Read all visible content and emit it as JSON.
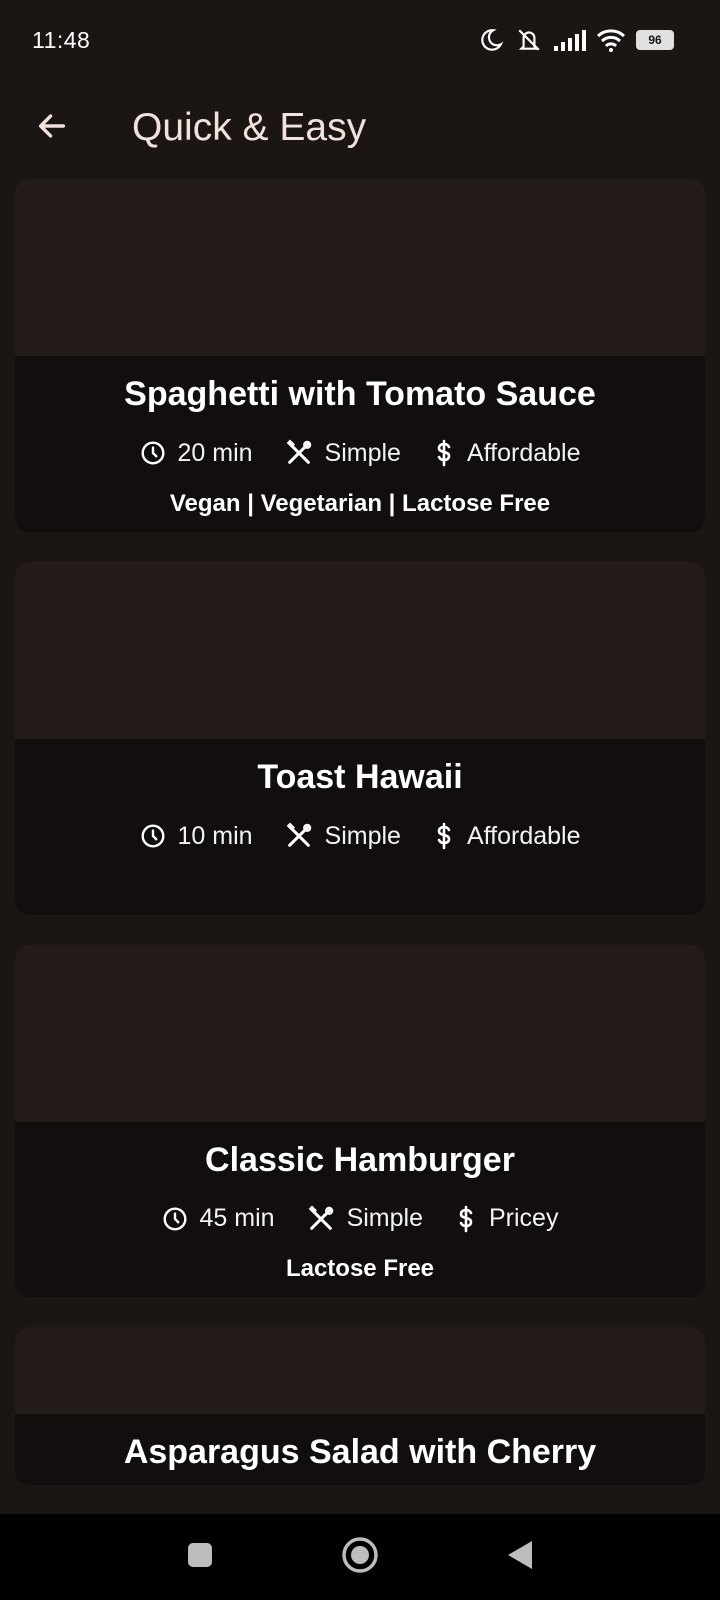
{
  "status_bar": {
    "time": "11:48",
    "battery": "96",
    "icons": [
      "moon-icon",
      "mute-icon",
      "signal-icon",
      "wifi-icon",
      "battery-icon"
    ]
  },
  "app_bar": {
    "title": "Quick & Easy",
    "back_icon": "arrow-back-icon"
  },
  "meals": [
    {
      "title": "Spaghetti with Tomato Sauce",
      "duration": "20 min",
      "complexity": "Simple",
      "affordability": "Affordable",
      "tags": "Vegan | Vegetarian | Lactose Free"
    },
    {
      "title": "Toast Hawaii",
      "duration": "10 min",
      "complexity": "Simple",
      "affordability": "Affordable",
      "tags": ""
    },
    {
      "title": "Classic Hamburger",
      "duration": "45 min",
      "complexity": "Simple",
      "affordability": "Pricey",
      "tags": "Lactose Free"
    },
    {
      "title": "Asparagus Salad with Cherry",
      "duration": "",
      "complexity": "",
      "affordability": "",
      "tags": ""
    }
  ],
  "nav_bar": {
    "icons": [
      "recents-square-icon",
      "home-circle-icon",
      "back-triangle-icon"
    ]
  },
  "colors": {
    "background": "#1b1514",
    "card": "#120e0d",
    "card_image_placeholder": "#241c19",
    "title_text": "#f2e2dc"
  }
}
